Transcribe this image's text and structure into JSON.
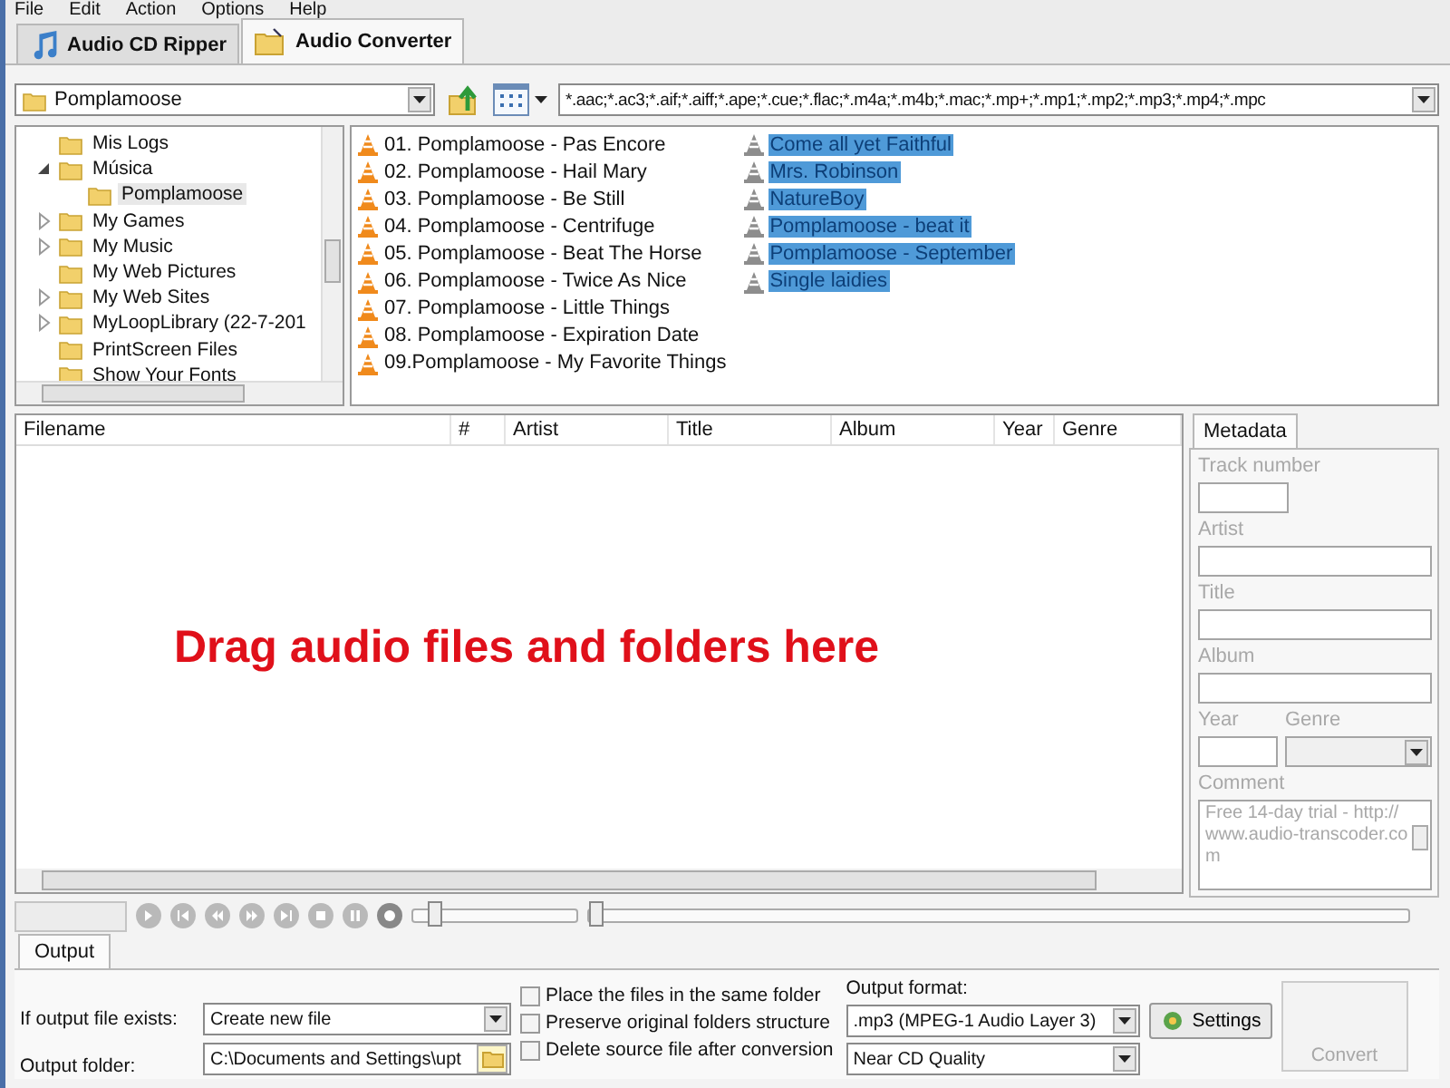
{
  "menu": [
    "File",
    "Edit",
    "Action",
    "Options",
    "Help"
  ],
  "tabs": [
    {
      "label": "Audio CD Ripper",
      "kind": "ripper",
      "selected": false
    },
    {
      "label": "Audio Converter",
      "kind": "converter",
      "selected": true
    }
  ],
  "toolbar": {
    "folder": "Pomplamoose",
    "filter": "*.aac;*.ac3;*.aif;*.aiff;*.ape;*.cue;*.flac;*.m4a;*.m4b;*.mac;*.mp+;*.mp1;*.mp2;*.mp3;*.mp4;*.mpc"
  },
  "tree": {
    "items": [
      {
        "label": "Mis Logs",
        "kind": "leaf",
        "selected": false
      },
      {
        "label": "Música",
        "kind": "branch",
        "expanded": true,
        "selected": false,
        "children": [
          {
            "label": "Pomplamoose",
            "kind": "leaf",
            "selected": true
          }
        ]
      },
      {
        "label": "My Games",
        "kind": "branch",
        "expanded": false,
        "selected": false
      },
      {
        "label": "My Music",
        "kind": "branch",
        "expanded": false,
        "selected": false
      },
      {
        "label": "My Web Pictures",
        "kind": "leaf",
        "selected": false
      },
      {
        "label": "My Web Sites",
        "kind": "branch",
        "expanded": false,
        "selected": false
      },
      {
        "label": "MyLoopLibrary (22-7-201",
        "kind": "branch",
        "expanded": false,
        "selected": false
      },
      {
        "label": "PrintScreen Files",
        "kind": "leaf",
        "selected": false
      },
      {
        "label": "Show Your Fonts",
        "kind": "leaf",
        "selected": false
      }
    ]
  },
  "files": [
    {
      "name": "01. Pomplamoose - Pas Encore",
      "selected": false
    },
    {
      "name": "02. Pomplamoose - Hail Mary",
      "selected": false
    },
    {
      "name": "03. Pomplamoose - Be Still",
      "selected": false
    },
    {
      "name": "04. Pomplamoose - Centrifuge",
      "selected": false
    },
    {
      "name": "05. Pomplamoose - Beat The Horse",
      "selected": false
    },
    {
      "name": "06. Pomplamoose - Twice As Nice",
      "selected": false
    },
    {
      "name": "07. Pomplamoose - Little Things",
      "selected": false
    },
    {
      "name": "08. Pomplamoose - Expiration Date",
      "selected": false
    },
    {
      "name": "09.Pomplamoose - My Favorite Things",
      "selected": false
    },
    {
      "name": "Come all yet Faithful",
      "selected": true
    },
    {
      "name": "Mrs. Robinson",
      "selected": true
    },
    {
      "name": "NatureBoy",
      "selected": true
    },
    {
      "name": "Pomplamoose - beat it",
      "selected": true
    },
    {
      "name": "Pomplamoose - September",
      "selected": true
    },
    {
      "name": "Single laidies",
      "selected": true
    }
  ],
  "table": {
    "columns": [
      "Filename",
      "#",
      "Artist",
      "Title",
      "Album",
      "Year",
      "Genre"
    ],
    "message": "Drag audio files and folders here"
  },
  "metadata": {
    "tab": "Metadata",
    "disabled": true,
    "fields": [
      {
        "label": "Track number",
        "kind": "short"
      },
      {
        "label": "Artist",
        "kind": "text"
      },
      {
        "label": "Title",
        "kind": "text"
      },
      {
        "label": "Album",
        "kind": "text"
      },
      {
        "label": "Year",
        "kind": "year"
      },
      {
        "label": "Genre",
        "kind": "combo"
      },
      {
        "label": "Comment",
        "kind": "memo",
        "value": "Free 14-day trial - http://www.audio-transcoder.com"
      }
    ]
  },
  "player": {
    "volume": {
      "level": 0.1
    },
    "position": {
      "level": 0.0
    }
  },
  "output": {
    "tab": "Output",
    "if_exists_label": "If output file exists:",
    "if_exists": "Create new file",
    "folder_label": "Output folder:",
    "folder": "C:\\Documents and Settings\\upt",
    "options": [
      {
        "label": "Place the files in the same folder",
        "checked": false
      },
      {
        "label": "Preserve original folders structure",
        "checked": false
      },
      {
        "label": "Delete source file after conversion",
        "checked": false
      }
    ],
    "format_label": "Output format:",
    "format": ".mp3 (MPEG-1 Audio Layer 3)",
    "quality": "Near CD Quality",
    "settings": "Settings",
    "convert": {
      "label": "Convert",
      "disabled": true
    }
  }
}
